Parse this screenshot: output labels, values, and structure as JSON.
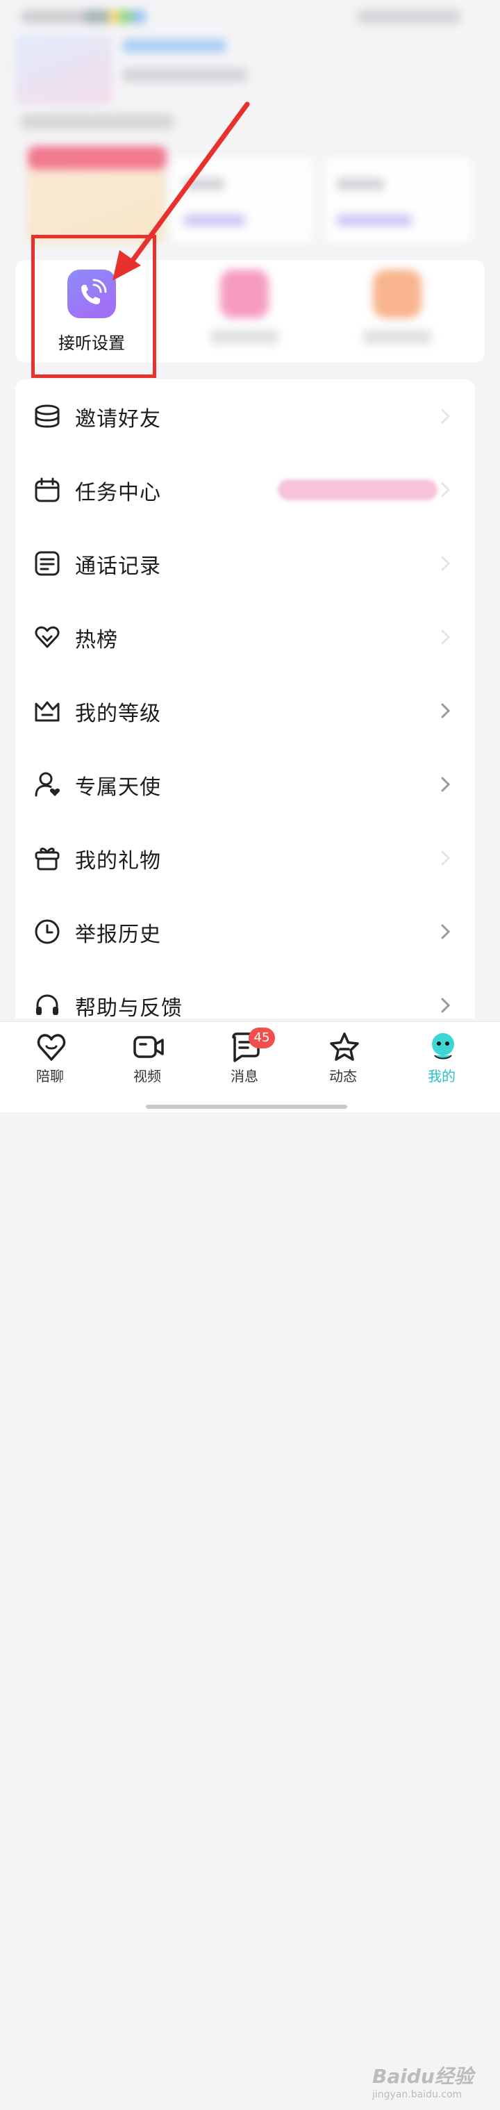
{
  "quick_actions": [
    {
      "label": "接听设置",
      "icon": "phone-call-icon"
    },
    {
      "label": "",
      "icon": "blurred-pink-icon"
    },
    {
      "label": "",
      "icon": "blurred-orange-icon"
    }
  ],
  "menu": {
    "items": [
      {
        "label": "邀请好友",
        "icon": "coins-stack-icon"
      },
      {
        "label": "任务中心",
        "icon": "calendar-icon"
      },
      {
        "label": "通话记录",
        "icon": "document-icon"
      },
      {
        "label": "热榜",
        "icon": "heart-outline-icon"
      },
      {
        "label": "我的等级",
        "icon": "crown-icon"
      },
      {
        "label": "专属天使",
        "icon": "user-heart-icon"
      },
      {
        "label": "我的礼物",
        "icon": "gift-icon"
      },
      {
        "label": "举报历史",
        "icon": "clock-icon"
      },
      {
        "label": "帮助与反馈",
        "icon": "headset-icon"
      }
    ]
  },
  "nav": {
    "tabs": [
      {
        "label": "陪聊",
        "icon": "heart-icon"
      },
      {
        "label": "视频",
        "icon": "video-camera-icon"
      },
      {
        "label": "消息",
        "icon": "message-icon",
        "badge": "45"
      },
      {
        "label": "动态",
        "icon": "star-icon"
      },
      {
        "label": "我的",
        "icon": "profile-mascot-icon",
        "active": true
      }
    ]
  },
  "watermark": {
    "title": "Baidu经验",
    "sub": "jingyan.baidu.com"
  },
  "colors": {
    "accent": "#27c3c4",
    "annotation": "#e8302d",
    "badge": "#f24e4b",
    "call_icon": "#9a7cf7"
  }
}
